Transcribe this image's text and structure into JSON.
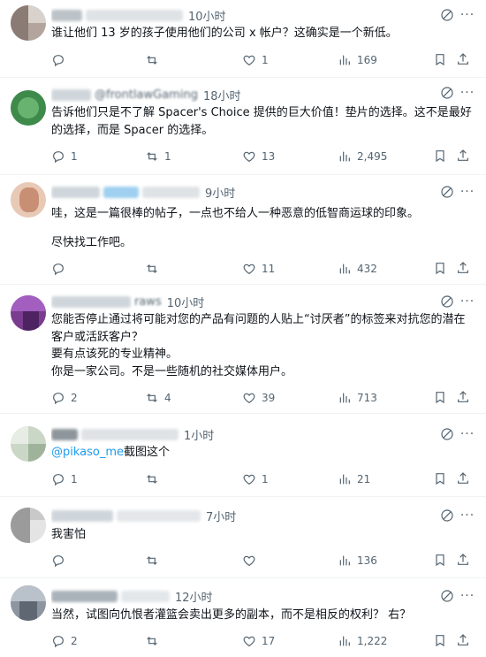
{
  "icons": {
    "reply": "speech-bubble",
    "retweet": "repost-arrows",
    "like": "heart",
    "views": "bar-chart",
    "bookmark": "bookmark",
    "share": "share-up-arrow",
    "grok": "grok-slash-circle",
    "more": "more-dots"
  },
  "colors": {
    "text": "#0f1419",
    "secondary": "#536471",
    "link": "#1d9bf0",
    "divider": "#eff3f4"
  },
  "tweets": [
    {
      "name": "",
      "handle": "",
      "time": "10小时",
      "text": "谁让他们 13 岁的孩子使用他们的公司 x 帐户？这确实是一个新低。",
      "reply": "",
      "retweet": "",
      "like": "1",
      "views": "169"
    },
    {
      "name": "",
      "handle": "@frontlawGaming",
      "time": "18小时",
      "text": "告诉他们只是不了解 Spacer's Choice 提供的巨大价值！垫片的选择。这不是最好的选择，而是 Spacer 的选择。",
      "reply": "1",
      "retweet": "1",
      "like": "13",
      "views": "2,495"
    },
    {
      "name": "",
      "handle": "",
      "time": "9小时",
      "text_lines": [
        "哇，这是一篇很棒的帖子，一点也不给人一种恶意的低智商运球的印象。",
        "",
        "尽快找工作吧。"
      ],
      "reply": "",
      "retweet": "",
      "like": "11",
      "views": "432"
    },
    {
      "name": "",
      "handle": "raws",
      "time": "10小时",
      "text_lines": [
        "您能否停止通过将可能对您的产品有问题的人贴上“讨厌者”的标签来对抗您的潜在客户或活跃客户？",
        "要有点该死的专业精神。",
        "你是一家公司。不是一些随机的社交媒体用户。"
      ],
      "reply": "2",
      "retweet": "4",
      "like": "39",
      "views": "713"
    },
    {
      "name": "",
      "handle": "",
      "time": "1小时",
      "mention": "@pikaso_me",
      "text_after": "截图这个",
      "reply": "1",
      "retweet": "",
      "like": "1",
      "views": "21"
    },
    {
      "name": "",
      "handle": "",
      "time": "7小时",
      "text": "我害怕",
      "reply": "",
      "retweet": "",
      "like": "",
      "views": "136"
    },
    {
      "name": "",
      "handle": "",
      "time": "12小时",
      "text": "当然，试图向仇恨者灌篮会卖出更多的副本，而不是相反的权利？ 右？",
      "reply": "2",
      "retweet": "",
      "like": "17",
      "views": "1,222"
    }
  ]
}
